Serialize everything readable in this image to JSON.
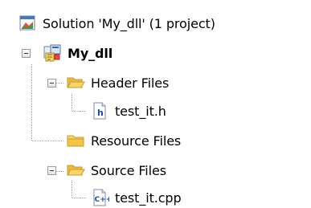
{
  "solution_explorer": {
    "solution": {
      "label": "Solution 'My_dll' (1 project)",
      "icon": "solution-icon"
    },
    "project": {
      "label": "My_dll",
      "icon": "vc-project-icon",
      "expanded": true
    },
    "folders": [
      {
        "label": "Header Files",
        "icon": "folder-open-icon",
        "expanded": true,
        "files": [
          {
            "label": "test_it.h",
            "icon": "header-file-icon"
          }
        ]
      },
      {
        "label": "Resource Files",
        "icon": "folder-closed-icon",
        "expanded": false,
        "files": []
      },
      {
        "label": "Source Files",
        "icon": "folder-open-icon",
        "expanded": true,
        "files": [
          {
            "label": "test_it.cpp",
            "icon": "cpp-file-icon"
          }
        ]
      }
    ]
  },
  "colors": {
    "folder_fill": "#f7d46c",
    "folder_edge": "#c89a2c",
    "tree_line": "#a0a0a0",
    "file_badge": "#1c4fa3"
  }
}
